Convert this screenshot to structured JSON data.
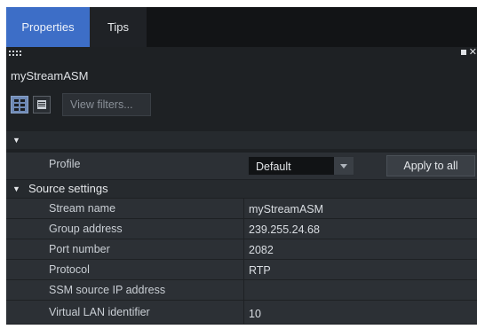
{
  "tabs": [
    {
      "label": "Properties",
      "active": true
    },
    {
      "label": "Tips",
      "active": false
    }
  ],
  "object_name": "myStreamASM",
  "toolbar": {
    "view_filters_label": "View filters..."
  },
  "profile_section": {
    "label": "",
    "profile_label": "Profile",
    "profile_value": "Default",
    "apply_label": "Apply to all"
  },
  "source_settings": {
    "label": "Source settings",
    "rows": [
      {
        "key": "Stream name",
        "value": "myStreamASM"
      },
      {
        "key": "Group address",
        "value": "239.255.24.68"
      },
      {
        "key": "Port number",
        "value": "2082"
      },
      {
        "key": "Protocol",
        "value": "RTP"
      },
      {
        "key": "SSM source IP address",
        "value": ""
      },
      {
        "key": "Virtual LAN identifier",
        "value": "10"
      }
    ]
  },
  "colors": {
    "accent": "#3d6ec7",
    "panel_bg": "#1e2124",
    "row_bg": "#2c3035"
  }
}
